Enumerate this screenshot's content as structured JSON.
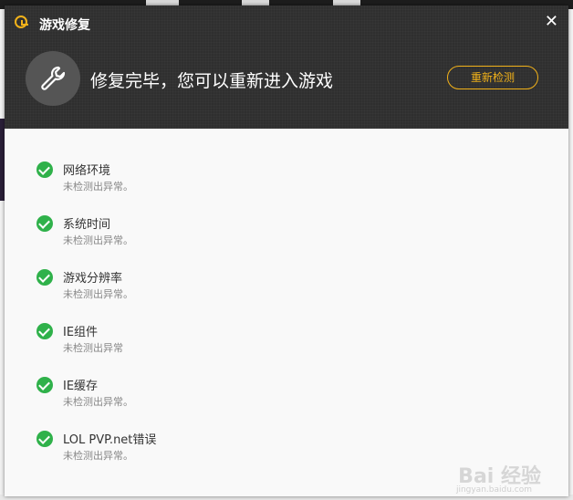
{
  "dialog": {
    "title": "游戏修复",
    "close_glyph": "✕",
    "headline": "修复完毕，您可以重新进入游戏",
    "recheck_label": "重新检测"
  },
  "checks": [
    {
      "name": "网络环境",
      "status": "未检测出异常。"
    },
    {
      "name": "系统时间",
      "status": "未检测出异常。"
    },
    {
      "name": "游戏分辨率",
      "status": "未检测出异常。"
    },
    {
      "name": "IE组件",
      "status": "未检测出异常"
    },
    {
      "name": "IE缓存",
      "status": "未检测出异常。"
    },
    {
      "name": "LOL PVP.net错误",
      "status": "未检测出异常。"
    }
  ],
  "watermark": {
    "brand": "Bai 经验",
    "url": "jingyan.baidu.com"
  },
  "colors": {
    "accent": "#f2b21a",
    "success": "#2fb14a",
    "header_bg": "#2f2f2f"
  },
  "icons": {
    "logo": "game-logo-icon",
    "tool": "wrench-icon",
    "ok": "check-circle-icon"
  }
}
